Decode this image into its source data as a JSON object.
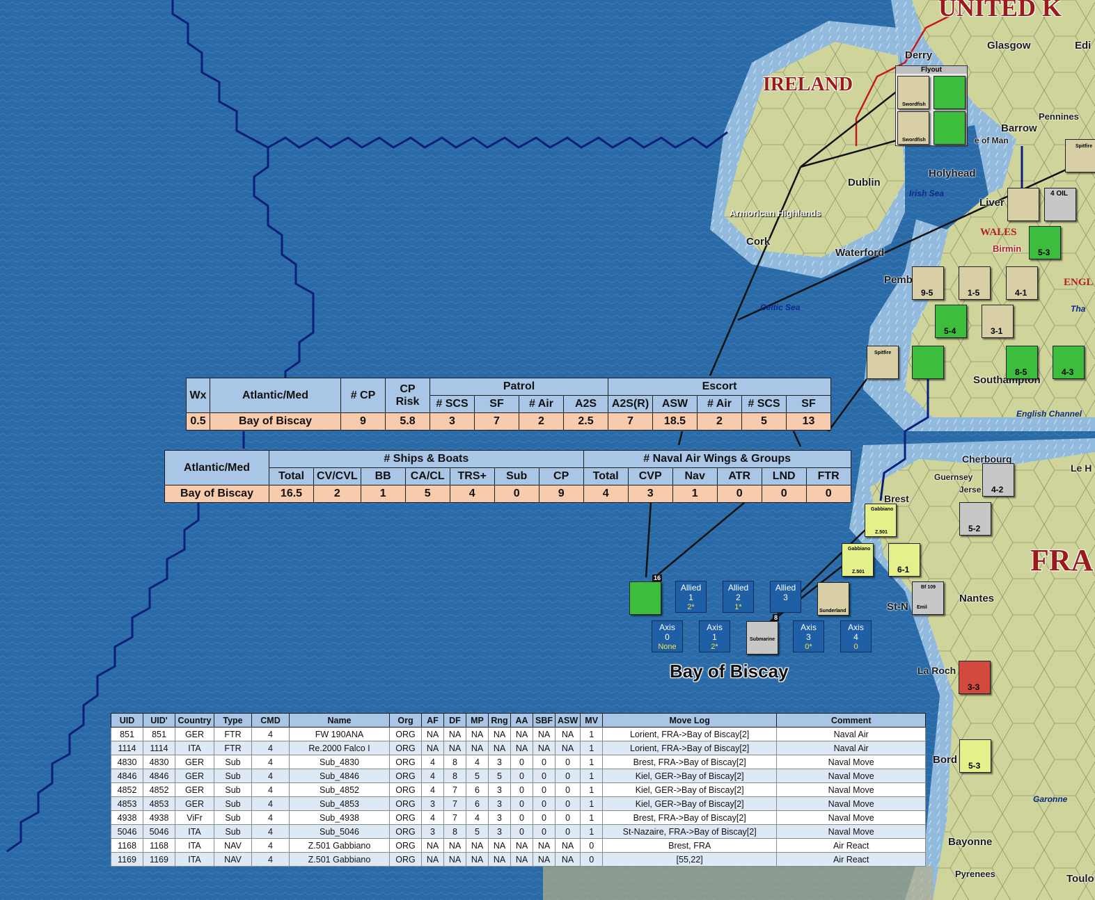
{
  "map_labels": {
    "country_uk": "UNITED K",
    "country_ireland": "IRELAND",
    "country_france": "FRA",
    "region_wales": "WALES",
    "region_england": "ENGL",
    "bay_label": "Bay of Biscay",
    "cities": {
      "derry": "Derry",
      "glasgow": "Glasgow",
      "edinburgh": "Edi",
      "barrow": "Barrow",
      "holyhead": "Holyhead",
      "dublin": "Dublin",
      "cork": "Cork",
      "waterford": "Waterford",
      "pemb": "Pemb",
      "southampton": "Southampton",
      "cherbourg": "Cherbourg",
      "guernsey": "Guernsey",
      "jersey": "Jerse",
      "brest": "Brest",
      "nantes": "Nantes",
      "st_n": "St-N",
      "la_roch": "La Roch",
      "bord": "Bord",
      "bayonne": "Bayonne",
      "pyrenees": "Pyrenees",
      "toulouse": "Toulous",
      "le": "Le H",
      "pennines": "Pennines",
      "isle_of_man": "e of Man",
      "liver": "Liver",
      "birm": "Birmin",
      "ma": "Ma"
    },
    "seas": {
      "irish_sea": "Irish Sea",
      "celtic_sea": "Celtic Sea",
      "english_channel": "English Channel",
      "garonne": "Garonne",
      "thames": "Tha"
    },
    "terrain_armorican": "Armorican Highlands"
  },
  "patrol_table": {
    "headers_top": [
      "Wx",
      "Atlantic/Med",
      "# CP",
      "CP Risk",
      "Patrol",
      "Escort"
    ],
    "headers_patrol": [
      "# SCS",
      "SF",
      "# Air",
      "A2S"
    ],
    "headers_escort": [
      "A2S(R)",
      "ASW",
      "# Air",
      "# SCS",
      "SF"
    ],
    "row": [
      "0.5",
      "Bay of Biscay",
      "9",
      "5.8",
      "3",
      "7",
      "2",
      "2.5",
      "7",
      "18.5",
      "2",
      "5",
      "13"
    ]
  },
  "ships_table": {
    "header_area": "Atlantic/Med",
    "group_ships": "# Ships & Boats",
    "group_air": "# Naval Air Wings & Groups",
    "headers_ships": [
      "Total",
      "CV/CVL",
      "BB",
      "CA/CL",
      "TRS+",
      "Sub",
      "CP"
    ],
    "headers_air": [
      "Total",
      "CVP",
      "Nav",
      "ATR",
      "LND",
      "FTR"
    ],
    "row": [
      "Bay of Biscay",
      "16.5",
      "2",
      "1",
      "5",
      "4",
      "0",
      "9",
      "4",
      "3",
      "1",
      "0",
      "0",
      "0"
    ]
  },
  "search_boxes": {
    "allied": [
      {
        "title": "Allied",
        "num": "1",
        "val": "2*"
      },
      {
        "title": "Allied",
        "num": "2",
        "val": "1*"
      },
      {
        "title": "Allied",
        "num": "3",
        "val": ""
      }
    ],
    "axis": [
      {
        "title": "Axis",
        "num": "0",
        "val": "None"
      },
      {
        "title": "Axis",
        "num": "1",
        "val": "2*"
      },
      {
        "title": "Axis",
        "num": "3",
        "val": "0*"
      },
      {
        "title": "Axis",
        "num": "4",
        "val": "0"
      }
    ]
  },
  "counters": {
    "flyout_title": "Flyout",
    "swordfish": "Swordfish",
    "spitfire": "Spitfire",
    "gabbiano": "Gabbiano",
    "z501": "Z.501",
    "submarine": "Submarine",
    "sunderland": "Sunderland",
    "bf109": "Bf 109",
    "emil": "Emil",
    "oil": "4 OIL",
    "stack_16": "16",
    "stack_8": "8",
    "unit_vals": [
      "5-3",
      "9-5",
      "1-5",
      "4-1",
      "5-4",
      "3-1",
      "8-5",
      "4-3",
      "4-2",
      "5-2",
      "6-1",
      "3-3",
      "5-3"
    ]
  },
  "unit_log": {
    "headers": [
      "UID",
      "UID'",
      "Country",
      "Type",
      "CMD",
      "Name",
      "Org",
      "AF",
      "DF",
      "MP",
      "Rng",
      "AA",
      "SBF",
      "ASW",
      "MV",
      "Move Log",
      "Comment"
    ],
    "rows": [
      [
        "851",
        "851",
        "GER",
        "FTR",
        "4",
        "FW 190ANA",
        "ORG",
        "NA",
        "NA",
        "NA",
        "NA",
        "NA",
        "NA",
        "NA",
        "1",
        "Lorient, FRA->Bay of Biscay[2]",
        "Naval Air"
      ],
      [
        "1114",
        "1114",
        "ITA",
        "FTR",
        "4",
        "Re.2000 Falco I",
        "ORG",
        "NA",
        "NA",
        "NA",
        "NA",
        "NA",
        "NA",
        "NA",
        "1",
        "Lorient, FRA->Bay of Biscay[2]",
        "Naval Air"
      ],
      [
        "4830",
        "4830",
        "GER",
        "Sub",
        "4",
        "Sub_4830",
        "ORG",
        "4",
        "8",
        "4",
        "3",
        "0",
        "0",
        "0",
        "1",
        "Brest, FRA->Bay of Biscay[2]",
        "Naval Move"
      ],
      [
        "4846",
        "4846",
        "GER",
        "Sub",
        "4",
        "Sub_4846",
        "ORG",
        "4",
        "8",
        "5",
        "5",
        "0",
        "0",
        "0",
        "1",
        "Kiel, GER->Bay of Biscay[2]",
        "Naval Move"
      ],
      [
        "4852",
        "4852",
        "GER",
        "Sub",
        "4",
        "Sub_4852",
        "ORG",
        "4",
        "7",
        "6",
        "3",
        "0",
        "0",
        "0",
        "1",
        "Kiel, GER->Bay of Biscay[2]",
        "Naval Move"
      ],
      [
        "4853",
        "4853",
        "GER",
        "Sub",
        "4",
        "Sub_4853",
        "ORG",
        "3",
        "7",
        "6",
        "3",
        "0",
        "0",
        "0",
        "1",
        "Kiel, GER->Bay of Biscay[2]",
        "Naval Move"
      ],
      [
        "4938",
        "4938",
        "ViFr",
        "Sub",
        "4",
        "Sub_4938",
        "ORG",
        "4",
        "7",
        "4",
        "3",
        "0",
        "0",
        "0",
        "1",
        "Brest, FRA->Bay of Biscay[2]",
        "Naval Move"
      ],
      [
        "5046",
        "5046",
        "ITA",
        "Sub",
        "4",
        "Sub_5046",
        "ORG",
        "3",
        "8",
        "5",
        "3",
        "0",
        "0",
        "0",
        "1",
        "St-Nazaire, FRA->Bay of Biscay[2]",
        "Naval Move"
      ],
      [
        "1168",
        "1168",
        "ITA",
        "NAV",
        "4",
        "Z.501 Gabbiano",
        "ORG",
        "NA",
        "NA",
        "NA",
        "NA",
        "NA",
        "NA",
        "NA",
        "0",
        "Brest, FRA",
        "Air React"
      ],
      [
        "1169",
        "1169",
        "ITA",
        "NAV",
        "4",
        "Z.501 Gabbiano",
        "ORG",
        "NA",
        "NA",
        "NA",
        "NA",
        "NA",
        "NA",
        "NA",
        "0",
        "[55,22]",
        "Air React"
      ]
    ]
  },
  "colors": {
    "sea": "#2a6aa6",
    "land": "#c9cf92",
    "header_blue": "#a9c6e6",
    "cell_peach": "#f8cbad",
    "boundary": "#0b1e7a"
  }
}
